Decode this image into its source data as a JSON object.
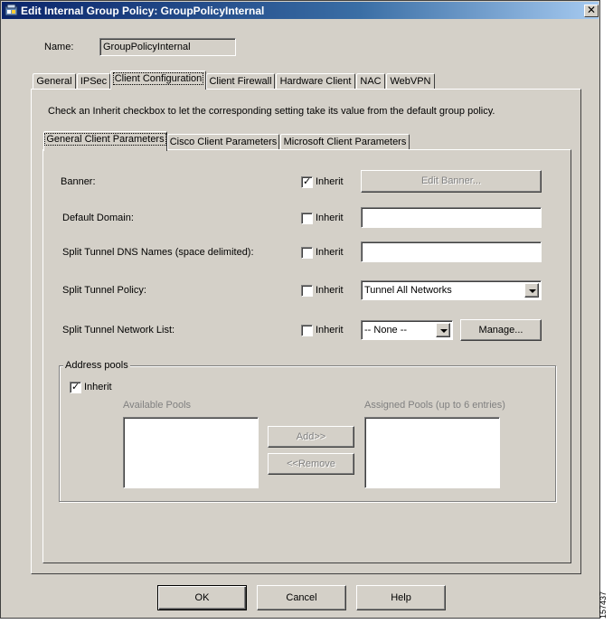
{
  "window": {
    "title": "Edit Internal Group Policy: GroupPolicyInternal",
    "close_glyph": "✕"
  },
  "name_field": {
    "label": "Name:",
    "value": "GroupPolicyInternal"
  },
  "main_tabs": [
    {
      "label": "General"
    },
    {
      "label": "IPSec"
    },
    {
      "label": "Client Configuration",
      "selected": true
    },
    {
      "label": "Client Firewall"
    },
    {
      "label": "Hardware Client"
    },
    {
      "label": "NAC"
    },
    {
      "label": "WebVPN"
    }
  ],
  "instruction": "Check an Inherit checkbox to let the corresponding setting take its value from the default group policy.",
  "sub_tabs": [
    {
      "label": "General Client Parameters",
      "selected": true
    },
    {
      "label": "Cisco Client Parameters"
    },
    {
      "label": "Microsoft Client Parameters"
    }
  ],
  "inherit_label": "Inherit",
  "rows": {
    "banner": {
      "label": "Banner:",
      "inherit": true,
      "button": "Edit Banner..."
    },
    "default_domain": {
      "label": "Default Domain:",
      "inherit": false,
      "value": ""
    },
    "split_dns": {
      "label": "Split Tunnel DNS Names (space delimited):",
      "inherit": false,
      "value": ""
    },
    "split_policy": {
      "label": "Split Tunnel Policy:",
      "inherit": false,
      "selected": "Tunnel All Networks"
    },
    "split_list": {
      "label": "Split Tunnel Network List:",
      "inherit": false,
      "selected": "-- None --",
      "button": "Manage..."
    }
  },
  "address_pools": {
    "legend": "Address pools",
    "inherit": true,
    "available_label": "Available Pools",
    "assigned_label": "Assigned Pools (up to 6 entries)",
    "add_button": "Add>>",
    "remove_button": "<<Remove"
  },
  "footer": {
    "ok": "OK",
    "cancel": "Cancel",
    "help": "Help"
  },
  "side_code": "157437",
  "colors": {
    "titlebar_start": "#0a246a",
    "titlebar_end": "#a6caf0",
    "face": "#d4d0c8"
  }
}
